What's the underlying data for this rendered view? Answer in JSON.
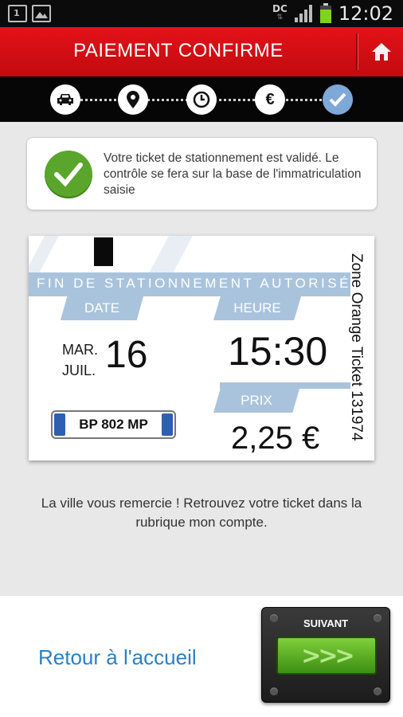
{
  "status_bar": {
    "notification_number": "1",
    "network_label": "DC",
    "time": "12:02"
  },
  "header": {
    "title": "PAIEMENT CONFIRME",
    "home_icon": "home-icon"
  },
  "steps": [
    {
      "icon": "car-icon",
      "state": "completed"
    },
    {
      "icon": "location-pin-icon",
      "state": "completed"
    },
    {
      "icon": "clock-icon",
      "state": "completed"
    },
    {
      "icon": "euro-icon",
      "label": "€",
      "state": "completed"
    },
    {
      "icon": "check-icon",
      "state": "current"
    }
  ],
  "confirmation": {
    "icon": "check-circle-icon",
    "message": "Votre ticket de stationnement est validé. Le contrôle se fera sur la base de l'immatriculation saisie"
  },
  "ticket": {
    "banner": "FIN DE STATIONNEMENT AUTORISÉ",
    "date_label": "DATE",
    "hour_label": "HEURE",
    "price_label": "PRIX",
    "weekday": "MAR.",
    "month": "JUIL.",
    "day": "16",
    "end_time": "15:30",
    "price": "2,25 €",
    "plate": "BP 802 MP",
    "side_text": "Zone Orange Ticket 131974"
  },
  "thanks_message": "La ville vous remercie ! Retrouvez votre ticket dans la rubrique mon compte.",
  "footer": {
    "home_link": "Retour à l'accueil",
    "next_label": "SUIVANT",
    "next_arrows": ">>>"
  },
  "colors": {
    "header_red": "#d40f15",
    "success_green": "#5aa52c",
    "ticket_blue": "#a9c3dc",
    "link_blue": "#2c7fc2"
  }
}
